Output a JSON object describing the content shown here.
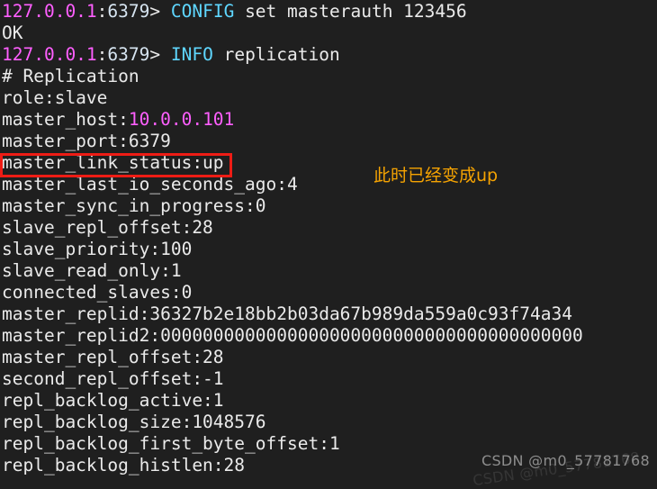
{
  "terminal": {
    "background_color": "#1f1f1f",
    "foreground_color": "#e8e8e8",
    "prompt_host": "127.0.0.1",
    "prompt_sep": ":",
    "prompt_port": "6379",
    "prompt_caret": "> ",
    "colors": {
      "host": "#ff5fff",
      "port": "#d6e4f0",
      "keyword": "#5fd7ff",
      "value_ip": "#ff5fff",
      "highlight_border": "#ee1c15",
      "annotation": "#f5a302"
    },
    "lines": [
      {
        "id": "cmd-config",
        "type": "prompt",
        "command_keyword": "CONFIG",
        "command_rest": " set masterauth 123456"
      },
      {
        "id": "reply-ok",
        "type": "plain",
        "text": "OK"
      },
      {
        "id": "cmd-info",
        "type": "prompt",
        "command_keyword": "INFO",
        "command_rest": " replication"
      },
      {
        "id": "section-replication",
        "type": "plain",
        "text": "# Replication"
      },
      {
        "id": "role",
        "type": "plain",
        "text": "role:slave"
      },
      {
        "id": "master-host",
        "type": "kv-ip",
        "key": "master_host:",
        "value": "10.0.0.101"
      },
      {
        "id": "master-port",
        "type": "plain",
        "text": "master_port:6379"
      },
      {
        "id": "master-link-status",
        "type": "plain",
        "text": "master_link_status:up"
      },
      {
        "id": "master-last-io-seconds-ago",
        "type": "plain",
        "text": "master_last_io_seconds_ago:4"
      },
      {
        "id": "master-sync-in-progress",
        "type": "plain",
        "text": "master_sync_in_progress:0"
      },
      {
        "id": "slave-repl-offset",
        "type": "plain",
        "text": "slave_repl_offset:28"
      },
      {
        "id": "slave-priority",
        "type": "plain",
        "text": "slave_priority:100"
      },
      {
        "id": "slave-read-only",
        "type": "plain",
        "text": "slave_read_only:1"
      },
      {
        "id": "connected-slaves",
        "type": "plain",
        "text": "connected_slaves:0"
      },
      {
        "id": "master-replid",
        "type": "plain",
        "text": "master_replid:36327b2e18bb2b03da67b989da559a0c93f74a34"
      },
      {
        "id": "master-replid2",
        "type": "plain",
        "text": "master_replid2:0000000000000000000000000000000000000000"
      },
      {
        "id": "master-repl-offset",
        "type": "plain",
        "text": "master_repl_offset:28"
      },
      {
        "id": "second-repl-offset",
        "type": "plain",
        "text": "second_repl_offset:-1"
      },
      {
        "id": "repl-backlog-active",
        "type": "plain",
        "text": "repl_backlog_active:1"
      },
      {
        "id": "repl-backlog-size",
        "type": "plain",
        "text": "repl_backlog_size:1048576"
      },
      {
        "id": "repl-backlog-first-byte-offset",
        "type": "plain",
        "text": "repl_backlog_first_byte_offset:1"
      },
      {
        "id": "repl-backlog-histlen",
        "type": "plain",
        "text": "repl_backlog_histlen:28"
      }
    ]
  },
  "annotation": {
    "text": "此时已经变成up"
  },
  "watermark": {
    "text": "CSDN @m0_57781768",
    "ghost_text": "CSDN @m0_57781768"
  }
}
